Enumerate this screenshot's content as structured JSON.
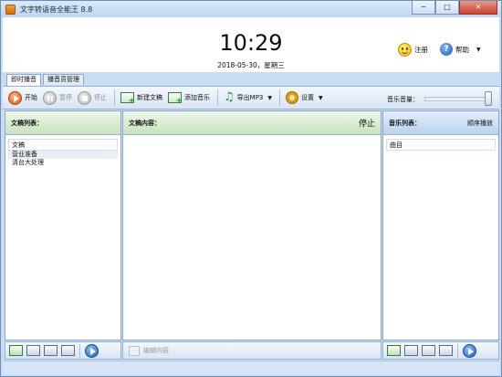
{
  "window": {
    "title": "文字转语音全能王 8.8",
    "minimize": "─",
    "maximize": "□",
    "close": "✕"
  },
  "clock": {
    "time": "10:29",
    "date": "2018-05-30，星期三"
  },
  "header": {
    "register_label": "注册",
    "help_label": "帮助",
    "menu_caret": "▼"
  },
  "tabs": [
    {
      "label": "即时播音",
      "active": true
    },
    {
      "label": "播音员管理",
      "active": false
    }
  ],
  "toolbar": {
    "start_label": "开始",
    "pause_label": "暂停",
    "stop_label": "停止",
    "new_doc_label": "新建文稿",
    "add_music_label": "添加音乐",
    "export_mp3_label": "导出MP3",
    "settings_label": "设置",
    "dropdown_caret": "▼",
    "volume_label": "音乐音量：",
    "volume_level": 1.0
  },
  "doc_list": {
    "title": "文稿列表：",
    "column_header": "文稿",
    "items": [
      "营业准备",
      "清台大处理"
    ]
  },
  "doc_content": {
    "title": "文稿内容：",
    "status": "停止"
  },
  "music_list": {
    "title": "音乐列表：",
    "order_mode": "顺序播放",
    "column_header": "曲目"
  },
  "bottom": {
    "edit_label": "编辑内容"
  }
}
